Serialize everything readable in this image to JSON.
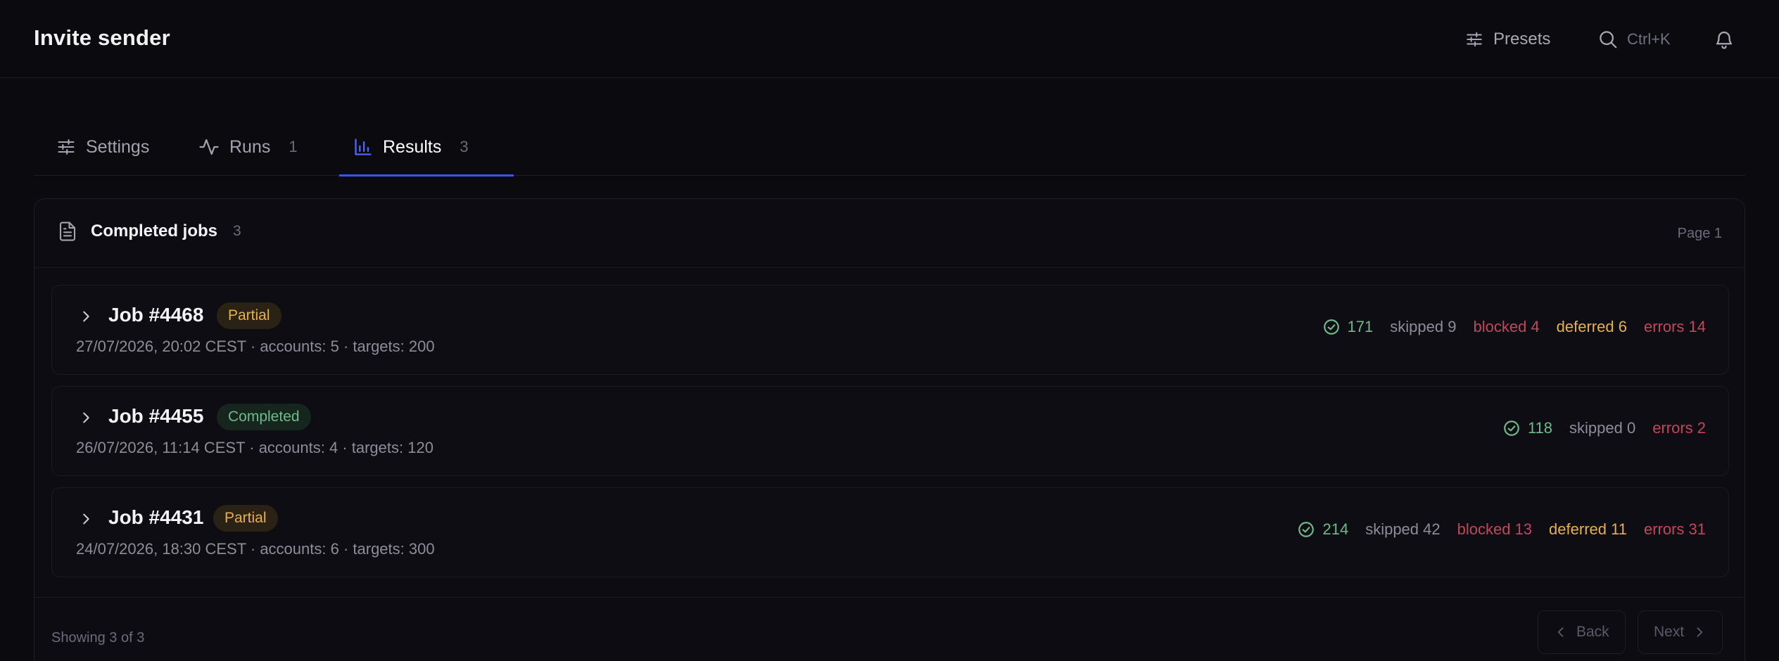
{
  "app": {
    "title": "Invite sender"
  },
  "topbar": {
    "presets_label": "Presets",
    "search_shortcut": "Ctrl+K"
  },
  "tabs": [
    {
      "label": "Settings",
      "count": ""
    },
    {
      "label": "Runs",
      "count": "1"
    },
    {
      "label": "Results",
      "count": "3",
      "active": true
    }
  ],
  "panel": {
    "title": "Completed jobs",
    "count": "3",
    "page_label": "Page 1"
  },
  "jobs": [
    {
      "name": "Job #4468",
      "status": "Partial",
      "meta": "27/07/2026, 20:02 CEST · accounts: 5 · targets: 200",
      "ok": "171",
      "skipped": "skipped 9",
      "blocked": "blocked 4",
      "deferred": "deferred 6",
      "errors": "errors 14"
    },
    {
      "name": "Job #4455",
      "status": "Completed",
      "meta": "26/07/2026, 11:14 CEST · accounts: 4 · targets: 120",
      "ok": "118",
      "skipped": "skipped 0",
      "errors": "errors 2"
    },
    {
      "name": "Job #4431",
      "status": "Partial",
      "meta": "24/07/2026, 18:30 CEST · accounts: 6 · targets: 300",
      "ok": "214",
      "skipped": "skipped 42",
      "blocked": "blocked 13",
      "deferred": "deferred 11",
      "errors": "errors 31"
    }
  ],
  "footer": {
    "showing": "Showing 3 of 3",
    "back_label": "Back",
    "next_label": "Next"
  },
  "colors": {
    "accent": "#3b55f0",
    "ok": "#6dbb8a",
    "warning": "#e8b04a",
    "danger": "#c2475a"
  },
  "icons": {
    "presets": "sliders-icon",
    "search": "search-icon",
    "bell": "bell-icon",
    "settings_tab": "sliders-icon",
    "runs_tab": "activity-icon",
    "results_tab": "bar-chart-icon",
    "panel": "document-icon",
    "expand": "chevron-right-icon",
    "ok": "check-circle-icon"
  }
}
